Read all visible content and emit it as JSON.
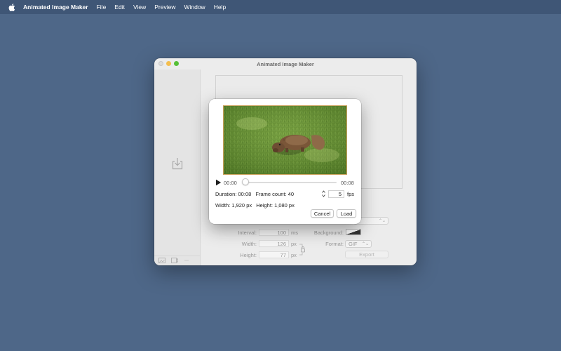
{
  "menubar": {
    "app_name": "Animated Image Maker",
    "items": [
      "File",
      "Edit",
      "View",
      "Preview",
      "Window",
      "Help"
    ]
  },
  "window": {
    "title": "Animated Image Maker"
  },
  "settings": {
    "interval_label": "Interval:",
    "interval_value": "100",
    "interval_unit": "ms",
    "width_label": "Width:",
    "width_value": "126",
    "width_unit": "px",
    "height_label": "Height:",
    "height_value": "77",
    "height_unit": "px",
    "background_label": "Background:",
    "format_label": "Format:",
    "format_value": "GIF",
    "loop_popup_value": "r",
    "export_label": "Export"
  },
  "dialog": {
    "current_time": "00:00",
    "total_time": "00:08",
    "duration": "Duration: 00:08",
    "frame_count": "Frame count: 40",
    "fps_value": "5",
    "fps_unit": "fps",
    "width_info": "Width: 1,920 px",
    "height_info": "Height: 1,080 px",
    "cancel_label": "Cancel",
    "load_label": "Load",
    "playhead_fraction": 0
  },
  "colors": {
    "desktop": "#4e6788",
    "menubar": "#3f5676",
    "traffic_close": "#dcdcdc",
    "traffic_min": "#f4be4f",
    "traffic_max": "#57c038"
  },
  "icons": {
    "apple": "apple-icon",
    "drop": "import-tray-icon",
    "play": "play-icon",
    "lock": "aspect-lock-icon",
    "stepper": "stepper-icon"
  }
}
